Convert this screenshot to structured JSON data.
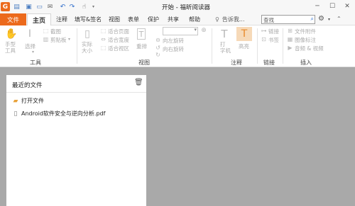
{
  "app": {
    "title": "开始 - 福昕阅读器",
    "logo": "G"
  },
  "quick_access": [
    {
      "name": "open-icon",
      "glyph": "▤"
    },
    {
      "name": "save-icon",
      "glyph": "▣"
    },
    {
      "name": "print-icon",
      "glyph": "▭"
    },
    {
      "name": "mail-icon",
      "glyph": "✉"
    },
    {
      "name": "undo-icon",
      "glyph": "↶"
    },
    {
      "name": "redo-icon",
      "glyph": "↷"
    },
    {
      "name": "hand-tool-icon",
      "glyph": "☝"
    }
  ],
  "window_controls": {
    "min": "─",
    "max": "☐",
    "close": "✕"
  },
  "tabs": {
    "file": "文件",
    "items": [
      "主页",
      "注释",
      "填写&签名",
      "视图",
      "表单",
      "保护",
      "共享",
      "帮助"
    ]
  },
  "tell_me": {
    "icon": "lightbulb-icon",
    "text": "告诉我..."
  },
  "search": {
    "placeholder": "查找"
  },
  "ribbon": {
    "hand_tool": "手型\n工具",
    "select": "选择",
    "screenshot": "截图",
    "clipboard": "剪贴板",
    "actual_size": "实际\n大小",
    "fit_page": "适合页面",
    "fit_width": "适合宽度",
    "fit_visible": "适合视区",
    "reflow": "重排",
    "rotate_left": "向左旋转",
    "rotate_right": "向右旋转",
    "typewriter": "打\n字机",
    "highlight": "高亮",
    "link": "链接",
    "bookmark": "书签",
    "file_attachment": "文件附件",
    "image_annotation": "图像标注",
    "audio_video": "音频 & 视频",
    "groups": {
      "tools": "工具",
      "view": "视图",
      "comment": "注释",
      "links": "链接",
      "insert": "插入"
    }
  },
  "recent_panel": {
    "title": "最近的文件",
    "open_file": "打开文件",
    "files": [
      "Android软件安全与逆向分析.pdf"
    ]
  }
}
